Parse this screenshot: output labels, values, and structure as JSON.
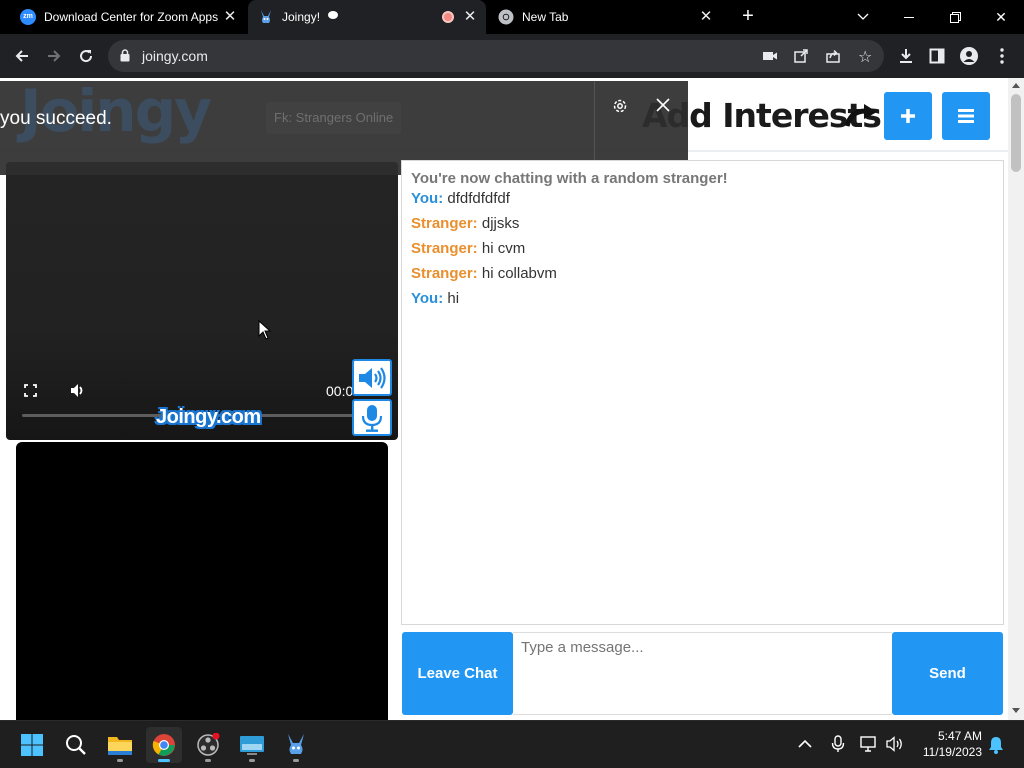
{
  "browser": {
    "tabs": [
      {
        "title": "Download Center for Zoom Apps",
        "favicon": "zoom-icon"
      },
      {
        "title": "Joingy!",
        "favicon": "joingy-bunny-icon",
        "active": true
      },
      {
        "title": "New Tab",
        "favicon": "chrome-icon"
      }
    ],
    "url": "joingy.com"
  },
  "toast": {
    "message": "you succeed.",
    "tooltip": "Fk: Strangers Online"
  },
  "header": {
    "title": "Add Interests"
  },
  "video": {
    "time": "00:0",
    "watermark": "Joingy.com"
  },
  "chat": {
    "status": "You're now chatting with a random stranger!",
    "messages": [
      {
        "speaker": "You:",
        "text": "dfdfdfdfdf"
      },
      {
        "speaker": "Stranger:",
        "text": "djjsks"
      },
      {
        "speaker": "Stranger:",
        "text": "hi cvm"
      },
      {
        "speaker": "Stranger:",
        "text": "hi collabvm"
      },
      {
        "speaker": "You:",
        "text": "hi"
      }
    ],
    "input_placeholder": "Type a message...",
    "leave_label": "Leave Chat",
    "send_label": "Send"
  },
  "taskbar": {
    "time": "5:47 AM",
    "date": "11/19/2023"
  },
  "colors": {
    "accent_blue": "#2196f3",
    "you_color": "#2a90d9",
    "stranger_color": "#e98f2e"
  }
}
